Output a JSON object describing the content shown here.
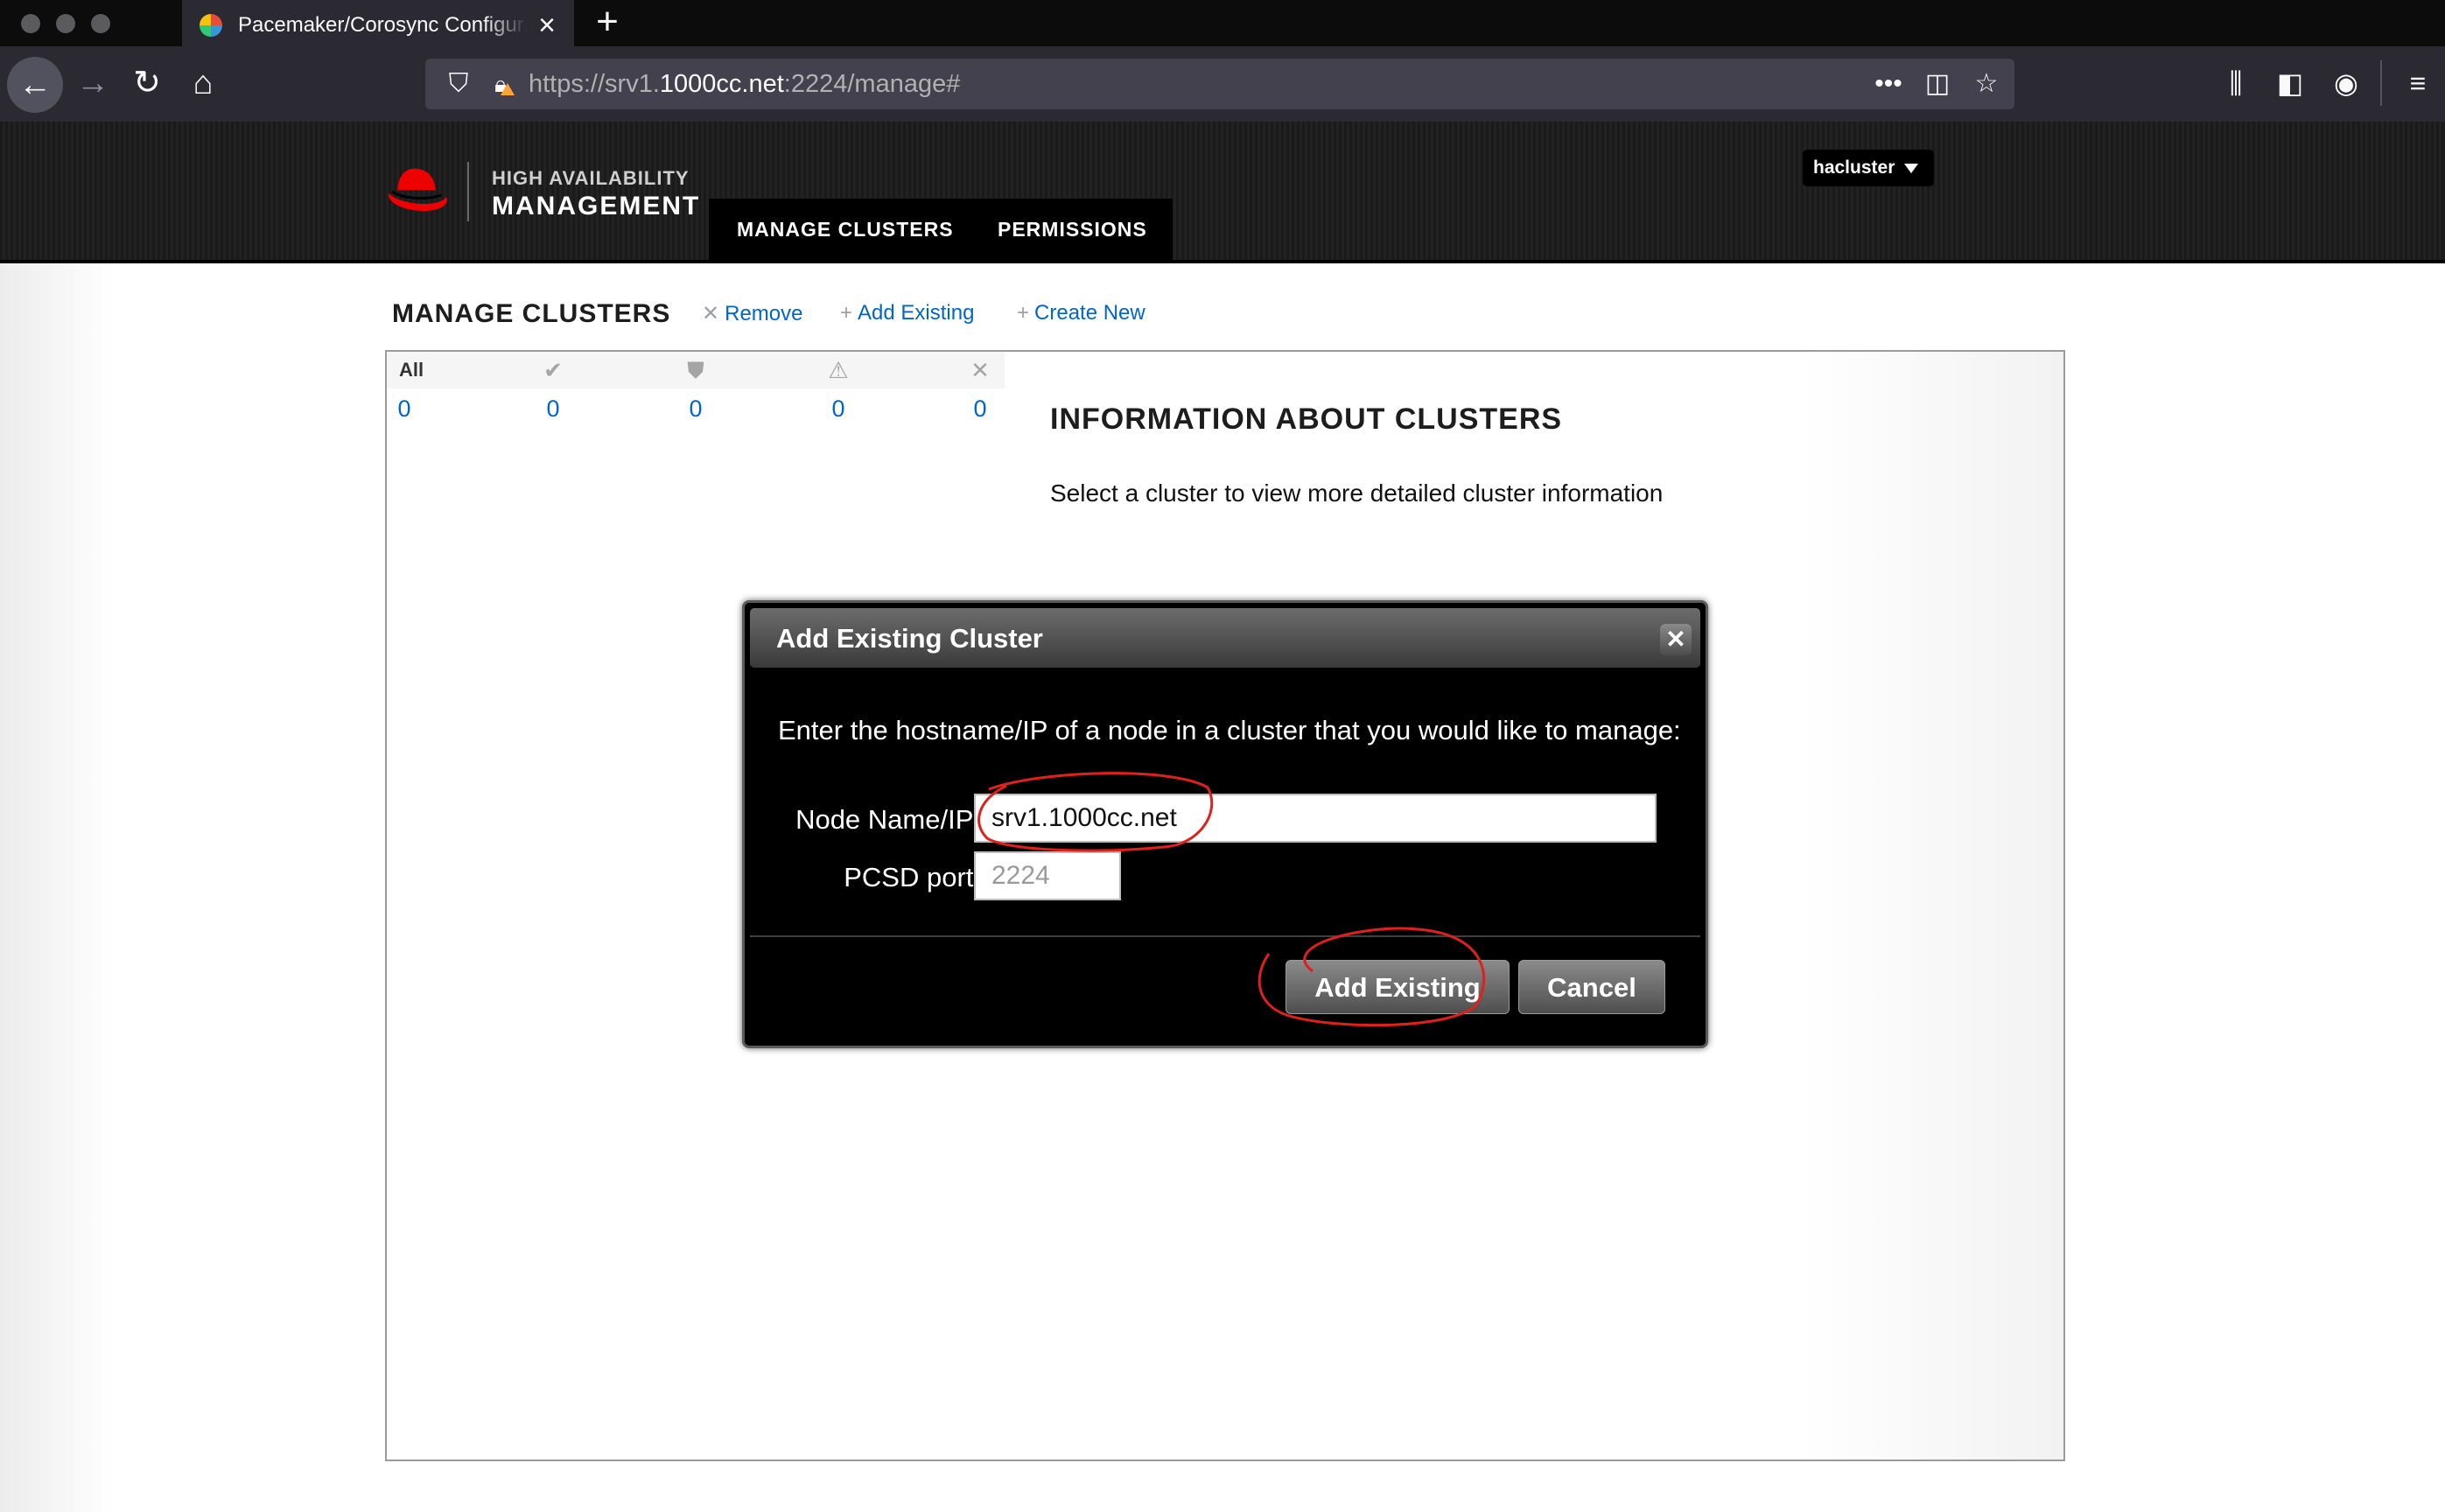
{
  "browser": {
    "tab_title": "Pacemaker/Corosync Configuration",
    "url_prefix": "https://srv1.",
    "url_host": "1000cc.net",
    "url_suffix": ":2224/manage#"
  },
  "app": {
    "logo_line1": "HIGH AVAILABILITY",
    "logo_line2": "MANAGEMENT",
    "nav": [
      "MANAGE CLUSTERS",
      "PERMISSIONS"
    ],
    "user": "hacluster",
    "brand_color": "#ee0000"
  },
  "page": {
    "title": "MANAGE CLUSTERS",
    "actions": {
      "remove": "Remove",
      "add_existing": "Add Existing",
      "create_new": "Create New"
    },
    "filter": {
      "all_label": "All",
      "counts": [
        "0",
        "0",
        "0",
        "0",
        "0"
      ]
    },
    "info_title": "INFORMATION ABOUT CLUSTERS",
    "info_text": "Select a cluster to view more detailed cluster information"
  },
  "dialog": {
    "title": "Add Existing Cluster",
    "prompt": "Enter the hostname/IP of a node in a cluster that you would like to manage:",
    "node_label": "Node Name/IP:",
    "node_value": "srv1.1000cc.net",
    "port_label": "PCSD port:",
    "port_placeholder": "2224",
    "add_button": "Add Existing",
    "cancel_button": "Cancel"
  },
  "annotation_color": "#e0201a"
}
